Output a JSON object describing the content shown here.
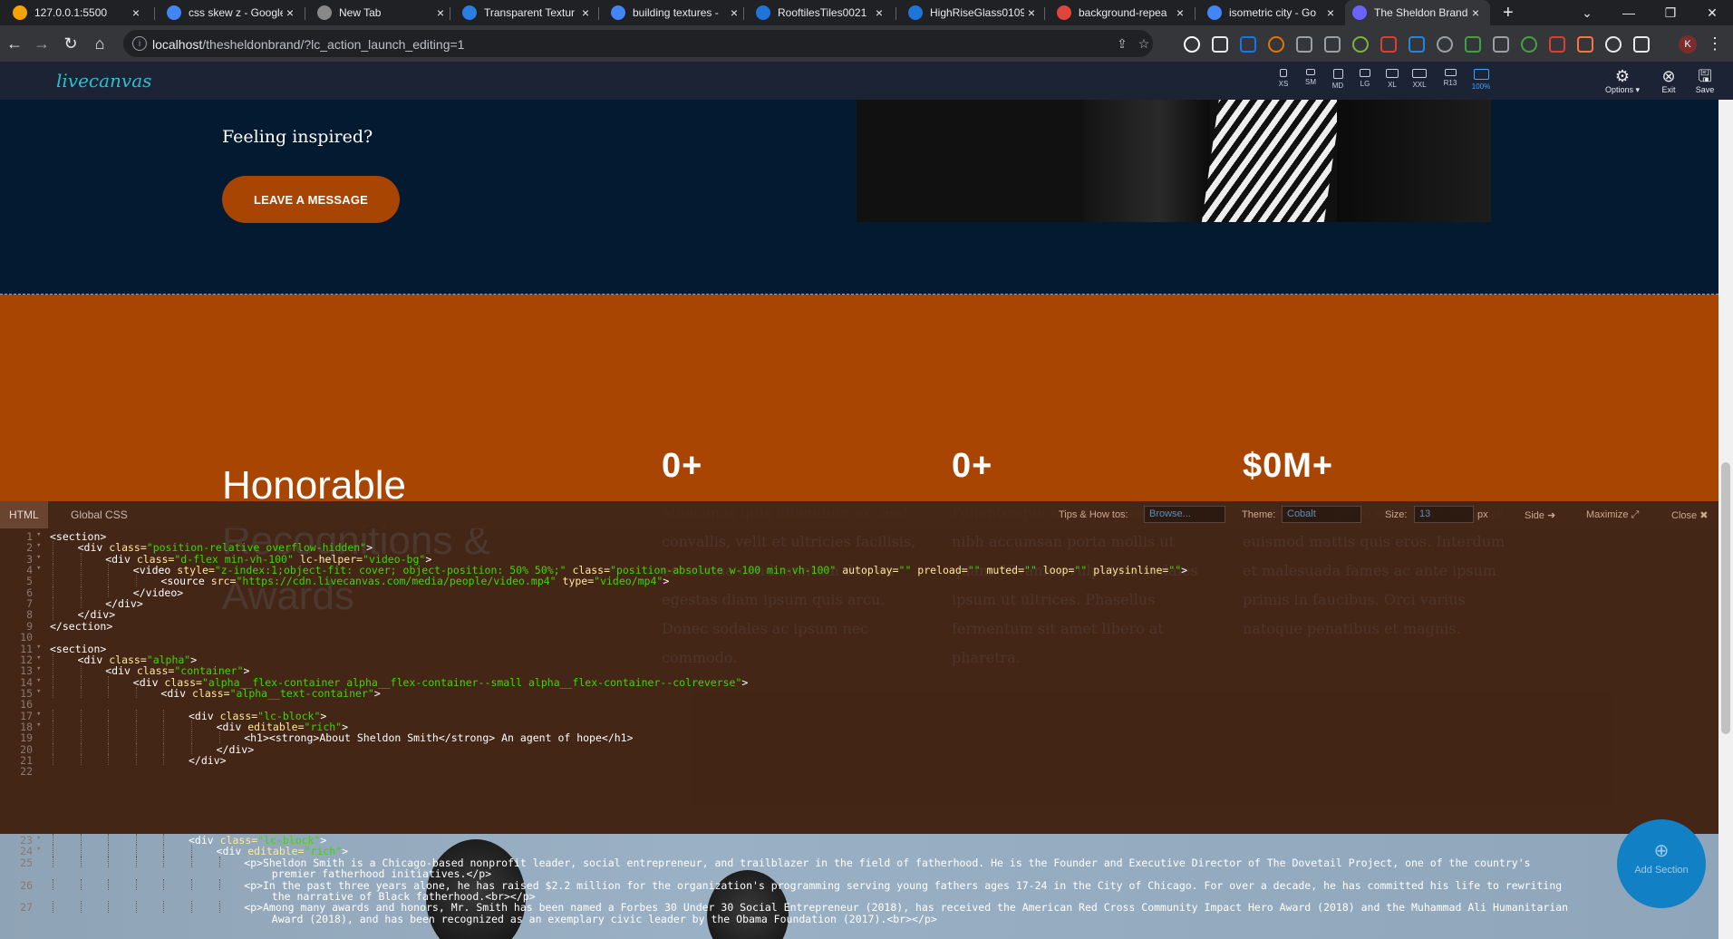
{
  "browser": {
    "tabs": [
      {
        "title": "127.0.0.1:5500",
        "favicon": "star-icon",
        "color": "#f4a300"
      },
      {
        "title": "css skew z - Google",
        "favicon": "google-icon",
        "color": "#4285f4"
      },
      {
        "title": "New Tab",
        "favicon": "chrome-icon",
        "color": "#888888"
      },
      {
        "title": "Transparent Textur",
        "favicon": "tt-icon",
        "color": "#2a7de1"
      },
      {
        "title": "building textures -",
        "favicon": "google-icon",
        "color": "#4285f4"
      },
      {
        "title": "RooftilesTiles0021",
        "favicon": "cube-icon",
        "color": "#1e74d8"
      },
      {
        "title": "HighRiseGlass0109",
        "favicon": "cube-icon",
        "color": "#1e74d8"
      },
      {
        "title": "background-repea",
        "favicon": "asterisk-icon",
        "color": "#e0443a"
      },
      {
        "title": "isometric city - Go",
        "favicon": "google-icon",
        "color": "#4285f4"
      },
      {
        "title": "The Sheldon Brand",
        "favicon": "livecanvas-icon",
        "color": "#6c63ff"
      }
    ],
    "active_tab_index": 9,
    "new_tab": "+",
    "url_host": "localhost",
    "url_path": "/thesheldonbrand/?lc_action_launch_editing=1",
    "profile_initial": "K"
  },
  "livecanvas": {
    "logo": "livecanvas",
    "viewports": [
      "XS",
      "SM",
      "MD",
      "LG",
      "XL",
      "XXL",
      "R13",
      "100%"
    ],
    "active_viewport": "100%",
    "actions": {
      "options": "Options ▾",
      "exit": "Exit",
      "save": "Save"
    }
  },
  "page": {
    "inspire_heading": "Feeling inspired?",
    "message_button": "LEAVE A MESSAGE",
    "recognitions_title": "Honorable Recognitions & Awards",
    "stats": [
      {
        "value": "0+",
        "text": "Maecenas quis bibendum ex. Sed convallis, velit et ultricies facilisis, est massa condimentum dui, eu egestas diam ipsum quis arcu. Donec sodales ac ipsum nec commodo."
      },
      {
        "value": "0+",
        "text": "Pellentesque sit amet mauris sed nibh accumsan porta mollis ut quam. Vivamus vulputate sodales ipsum ut ultrices. Phasellus fermentum sit amet libero at pharetra."
      },
      {
        "value": "$0M+",
        "text": "Vivamus in libero eget nibh tempus euismod mattis quis eros. Interdum et malesuada fames ac ante ipsum primis in faucibus. Orci varius natoque penatibus et magnis."
      }
    ],
    "add_section": "Add Section"
  },
  "editor": {
    "tabs": [
      "HTML",
      "Global CSS"
    ],
    "active_tab": "HTML",
    "tips_label": "Tips & How tos:",
    "tips_value": "Browse...",
    "theme_label": "Theme:",
    "theme_value": "Cobalt",
    "size_label": "Size:",
    "size_value": "13",
    "size_unit": "px",
    "side": "Side",
    "maximize": "Maximize",
    "close": "Close",
    "lines": [
      {
        "n": "1",
        "fold": true,
        "indent": 0,
        "code": "<section>"
      },
      {
        "n": "2",
        "fold": true,
        "indent": 1,
        "code": "<div class=\"position-relative overflow-hidden\">"
      },
      {
        "n": "3",
        "fold": true,
        "indent": 2,
        "code": "<div class=\"d-flex min-vh-100\" lc-helper=\"video-bg\">"
      },
      {
        "n": "4",
        "fold": true,
        "indent": 3,
        "code": "<video style=\"z-index:1;object-fit: cover; object-position: 50% 50%;\" class=\"position-absolute w-100 min-vh-100\" autoplay=\"\" preload=\"\" muted=\"\" loop=\"\" playsinline=\"\">"
      },
      {
        "n": "5",
        "fold": false,
        "indent": 4,
        "code": "<source src=\"https://cdn.livecanvas.com/media/people/video.mp4\" type=\"video/mp4\">"
      },
      {
        "n": "6",
        "fold": false,
        "indent": 3,
        "code": "</video>"
      },
      {
        "n": "7",
        "fold": false,
        "indent": 2,
        "code": "</div>"
      },
      {
        "n": "8",
        "fold": false,
        "indent": 1,
        "code": "</div>"
      },
      {
        "n": "9",
        "fold": false,
        "indent": 0,
        "code": "</section>"
      },
      {
        "n": "10",
        "fold": false,
        "indent": 0,
        "code": ""
      },
      {
        "n": "11",
        "fold": true,
        "indent": 0,
        "code": "<section>"
      },
      {
        "n": "12",
        "fold": true,
        "indent": 1,
        "code": "<div class=\"alpha\">"
      },
      {
        "n": "13",
        "fold": true,
        "indent": 2,
        "code": "<div class=\"container\">"
      },
      {
        "n": "14",
        "fold": true,
        "indent": 3,
        "code": "<div class=\"alpha__flex-container alpha__flex-container--small alpha__flex-container--colreverse\">"
      },
      {
        "n": "15",
        "fold": true,
        "indent": 4,
        "code": "<div class=\"alpha__text-container\">"
      },
      {
        "n": "16",
        "fold": false,
        "indent": 0,
        "code": ""
      },
      {
        "n": "17",
        "fold": true,
        "indent": 5,
        "code": "<div class=\"lc-block\">"
      },
      {
        "n": "18",
        "fold": true,
        "indent": 6,
        "code": "<div editable=\"rich\">"
      },
      {
        "n": "19",
        "fold": false,
        "indent": 7,
        "code": "<h1><strong>About Sheldon Smith</strong> An agent of hope</h1>"
      },
      {
        "n": "20",
        "fold": false,
        "indent": 6,
        "code": "</div>"
      },
      {
        "n": "21",
        "fold": false,
        "indent": 5,
        "code": "</div>"
      },
      {
        "n": "22",
        "fold": false,
        "indent": 0,
        "code": ""
      },
      {
        "n": "23",
        "fold": true,
        "indent": 5,
        "code": "<div class=\"lc-block\">"
      },
      {
        "n": "24",
        "fold": true,
        "indent": 6,
        "code": "<div editable=\"rich\">"
      },
      {
        "n": "25",
        "fold": false,
        "indent": 7,
        "code": "<p>Sheldon Smith is a Chicago-based nonprofit leader, social entrepreneur, and trailblazer in the field of fatherhood. He is the Founder and Executive Director of The Dovetail Project, one of the country's",
        "cont": "premier fatherhood initiatives.</p>"
      },
      {
        "n": "26",
        "fold": false,
        "indent": 7,
        "code": "<p>In the past three years alone, he has raised $2.2 million for the organization's programming serving young fathers ages 17-24 in the City of Chicago. For over a decade, he has committed his life to rewriting",
        "cont": "the narrative of Black fatherhood.<br></p>"
      },
      {
        "n": "27",
        "fold": false,
        "indent": 7,
        "code": "<p>Among many awards and honors, Mr. Smith has been named a Forbes 30 Under 30 Social Entrepreneur (2018), has received the American Red Cross Community Impact Hero Award (2018) and the Muhammad Ali Humanitarian",
        "cont": "Award (2018), and has been recognized as an exemplary civic leader by the Obama Foundation (2017).<br></p>"
      }
    ]
  }
}
